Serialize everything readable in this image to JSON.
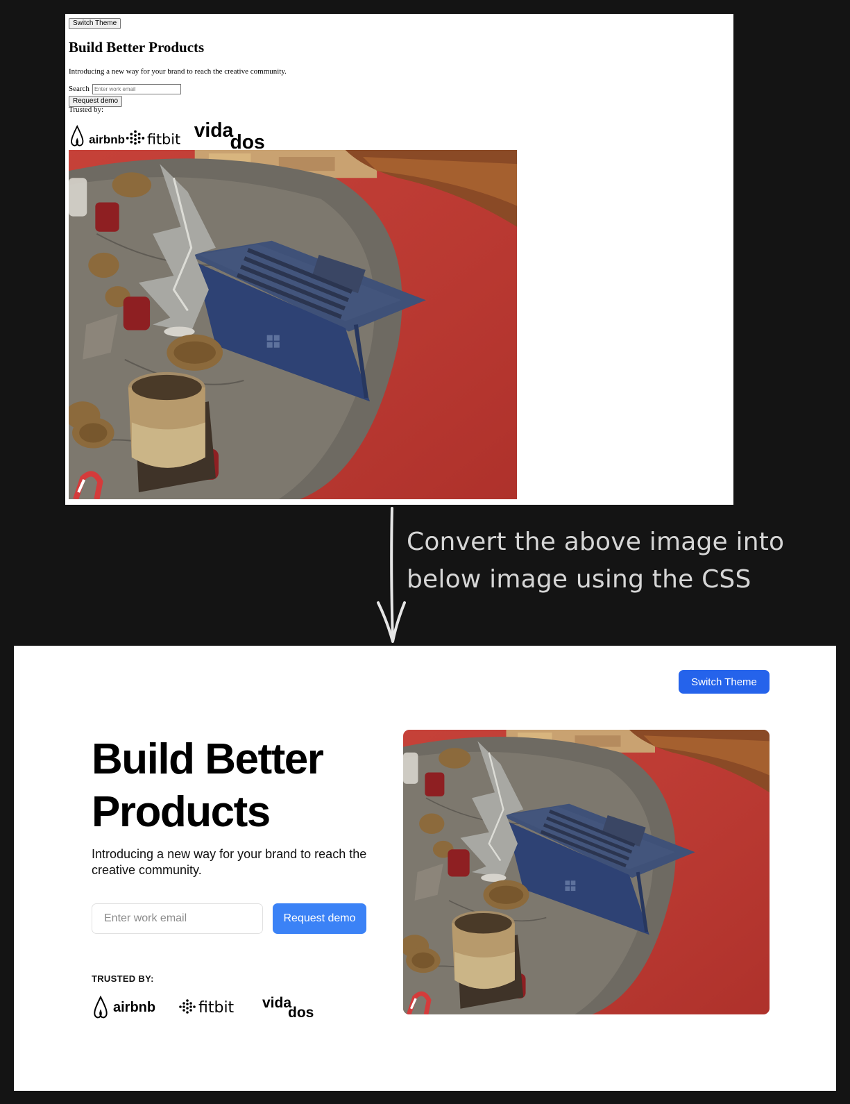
{
  "before": {
    "switch_theme": "Switch Theme",
    "title": "Build Better Products",
    "description": "Introducing a new way for your brand to reach the creative community.",
    "search_label": "Search",
    "email_placeholder": "Enter work email",
    "request_demo": "Request demo",
    "trusted_label": "Trusted by:"
  },
  "instruction": {
    "line1": "Convert the above image into",
    "line2": "below image using the CSS"
  },
  "after": {
    "switch_theme": "Switch Theme",
    "title_line1": "Build Better",
    "title_line2": "Products",
    "description": "Introducing a new way for your brand to reach the creative community.",
    "email_placeholder": "Enter work email",
    "request_demo": "Request demo",
    "trusted_label": "TRUSTED BY:"
  },
  "logos": [
    {
      "name": "airbnb",
      "icon": "airbnb-logo-icon"
    },
    {
      "name": "fitbit",
      "icon": "fitbit-logo-icon"
    },
    {
      "name": "vida",
      "icon": "vidados-logo-icon"
    },
    {
      "name": "dos",
      "icon": "vidados-logo-icon"
    }
  ],
  "colors": {
    "page_background": "#141414",
    "switch_theme_button": "#2563eb",
    "request_demo_button": "#3b82f6",
    "instruction_text": "#d6d6d6",
    "rug_red": "#c9423a"
  },
  "photo": {
    "subject": "laptop-on-stone-table-photo"
  }
}
